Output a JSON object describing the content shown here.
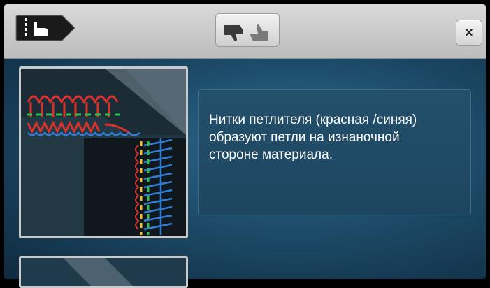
{
  "header": {
    "mode_icon": "hand-pointer-icon",
    "feedback_icon": "thumbs-down-up-icon",
    "close_label": "×"
  },
  "content": {
    "description": "Нитки петлителя (красная /синяя) образуют петли на изнаночной стороне материала."
  },
  "colors": {
    "red_thread": "#d8322d",
    "blue_thread": "#2f7fd6",
    "green_thread": "#2ec24d",
    "yellow_thread": "#f2c12e"
  }
}
